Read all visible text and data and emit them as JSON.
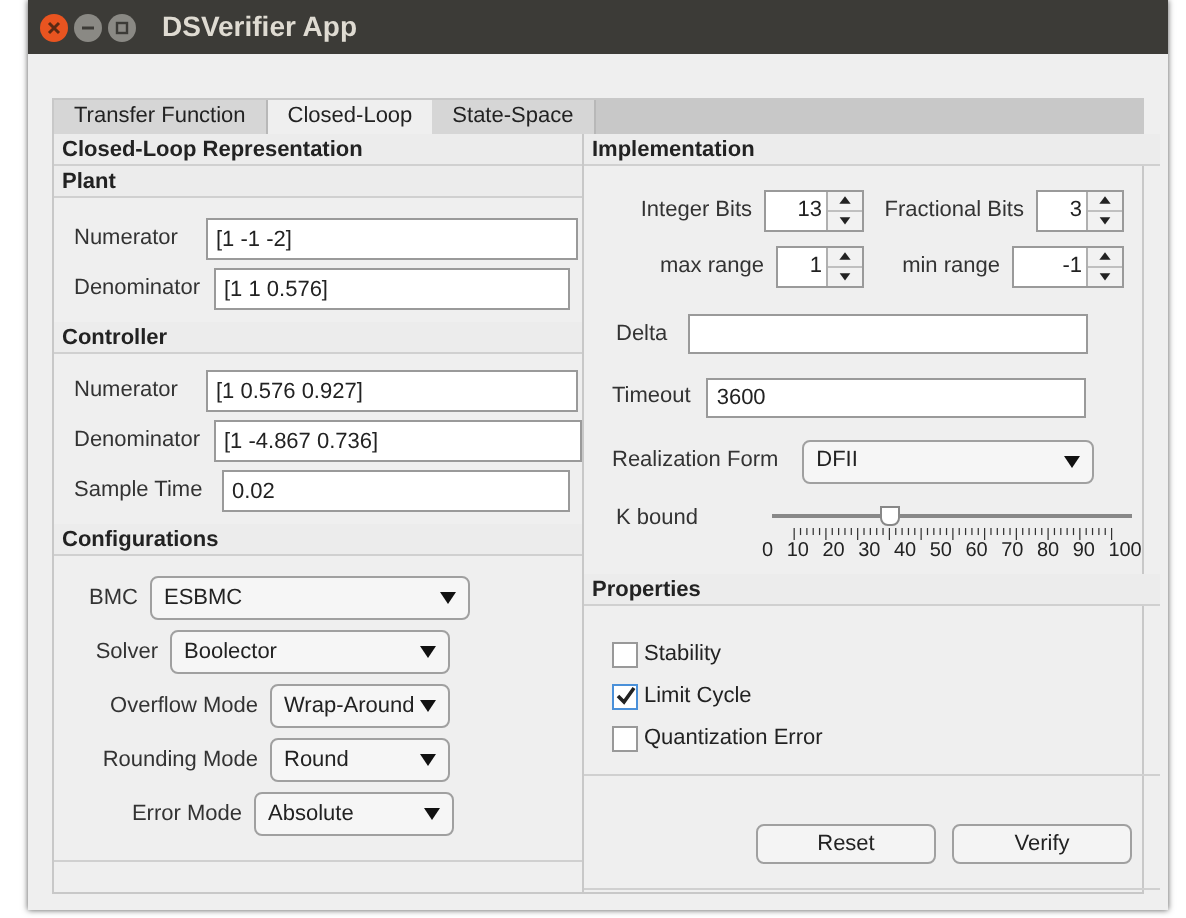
{
  "window": {
    "title": "DSVerifier App"
  },
  "tabs": [
    {
      "label": "Transfer Function",
      "selected": false
    },
    {
      "label": "Closed-Loop",
      "selected": true
    },
    {
      "label": "State-Space",
      "selected": false
    }
  ],
  "left": {
    "title": "Closed-Loop Representation",
    "plant": {
      "title": "Plant",
      "fields": [
        {
          "label": "Numerator",
          "value": "[1 -1 -2]"
        },
        {
          "label": "Denominator",
          "value": "[1 1 0.576]"
        }
      ]
    },
    "controller": {
      "title": "Controller",
      "fields": [
        {
          "label": "Numerator",
          "value": "[1 0.576 0.927]"
        },
        {
          "label": "Denominator",
          "value": "[1 -4.867 0.736]"
        },
        {
          "label": "Sample Time",
          "value": "0.02"
        }
      ]
    },
    "configurations": {
      "title": "Configurations",
      "dropdowns": [
        {
          "label": "BMC",
          "value": "ESBMC"
        },
        {
          "label": "Solver",
          "value": "Boolector"
        },
        {
          "label": "Overflow Mode",
          "value": "Wrap-Around"
        },
        {
          "label": "Rounding Mode",
          "value": "Round"
        },
        {
          "label": "Error  Mode",
          "value": "Absolute"
        }
      ]
    }
  },
  "implementation": {
    "title": "Implementation",
    "spinners": [
      {
        "label": "Integer Bits",
        "value": "13"
      },
      {
        "label": "Fractional Bits",
        "value": "3"
      },
      {
        "label": "max range",
        "value": "1"
      },
      {
        "label": "min range",
        "value": "-1"
      }
    ],
    "delta": {
      "label": "Delta"
    },
    "timeout": {
      "label": "Timeout",
      "value": "3600"
    },
    "realization": {
      "label": "Realization Form",
      "value": "DFII"
    },
    "k_bound": {
      "label": "K bound",
      "level": 0.33,
      "scale": [
        "0",
        "10",
        "20",
        "30",
        "40",
        "50",
        "60",
        "70",
        "80",
        "90",
        "100"
      ]
    }
  },
  "properties": {
    "title": "Properties",
    "checkboxes": [
      {
        "label": "Stability",
        "checked": false
      },
      {
        "label": "Limit Cycle",
        "checked": true
      },
      {
        "label": "Quantization Error",
        "checked": false
      }
    ]
  },
  "buttons": [
    "Reset",
    "Verify"
  ]
}
